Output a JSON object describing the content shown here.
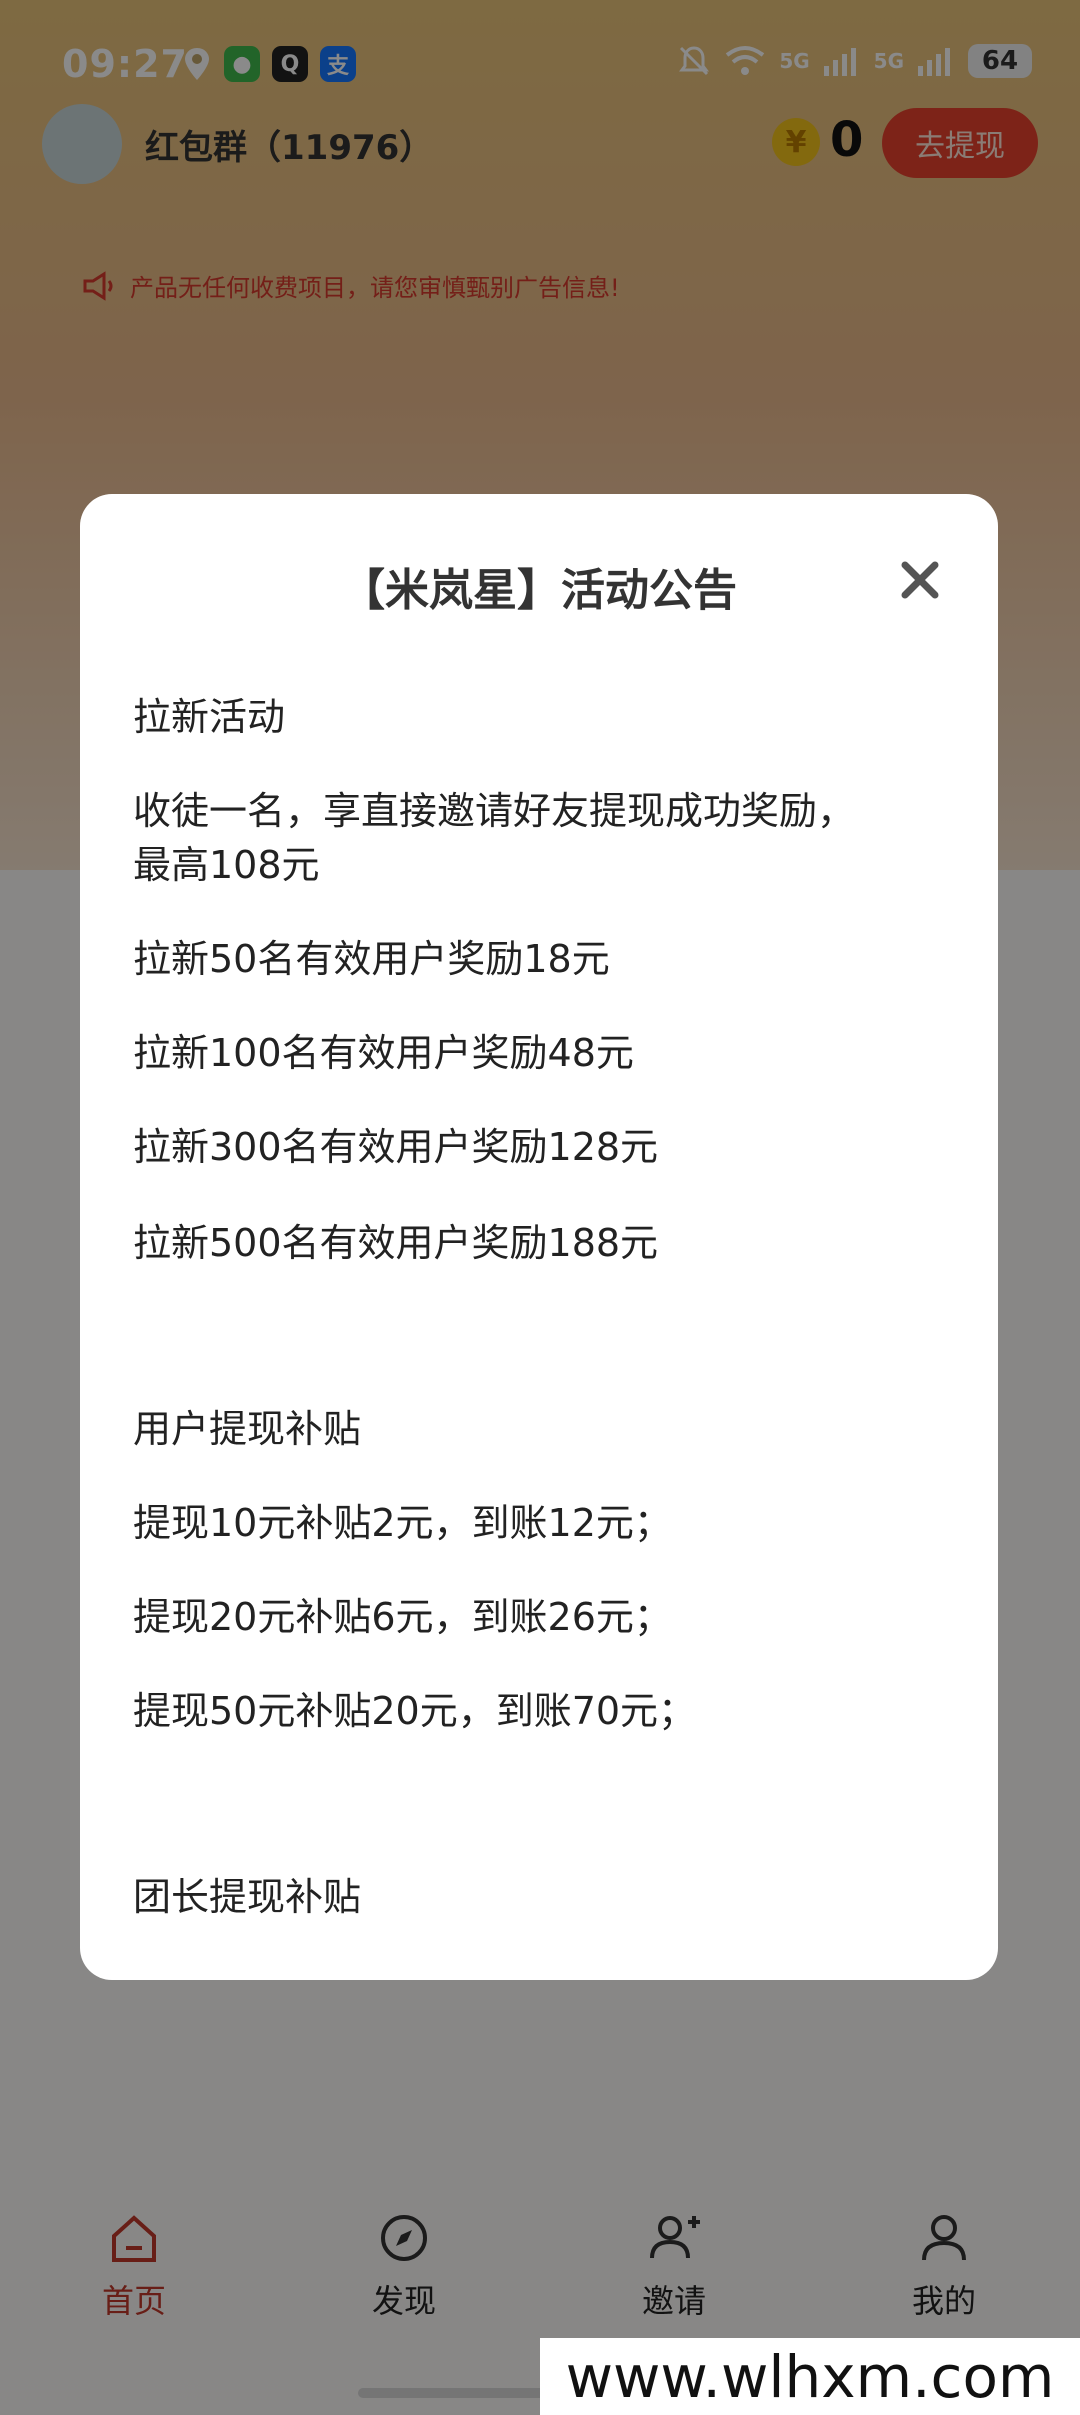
{
  "status_bar": {
    "time": "09:27",
    "battery": "64",
    "signal_1": "5G",
    "signal_2": "5G"
  },
  "header": {
    "group_title": "红包群（11976）",
    "coin_count": "0",
    "withdraw_label": "去提现"
  },
  "notice": {
    "text": "产品无任何收费项目，请您审慎甄别广告信息!"
  },
  "modal": {
    "title": "【米岚星】活动公告",
    "lines": [
      "拉新活动",
      "收徒一名，享直接邀请好友提现成功奖励，",
      "最高108元",
      "拉新50名有效用户奖励18元",
      "拉新100名有效用户奖励48元",
      "拉新300名有效用户奖励128元",
      "拉新500名有效用户奖励188元",
      "用户提现补贴",
      "提现10元补贴2元，到账12元；",
      "提现20元补贴6元，到账26元；",
      "提现50元补贴20元，到账70元；",
      "团长提现补贴"
    ]
  },
  "bottom_nav": [
    {
      "label": "首页",
      "icon": "home-icon",
      "active": true
    },
    {
      "label": "发现",
      "icon": "compass-icon",
      "active": false
    },
    {
      "label": "邀请",
      "icon": "add-user-icon",
      "active": false
    },
    {
      "label": "我的",
      "icon": "person-icon",
      "active": false
    }
  ],
  "watermark": "www.wlhxm.com",
  "colors": {
    "accent": "#e8422e",
    "nav_active": "#c0392b"
  }
}
